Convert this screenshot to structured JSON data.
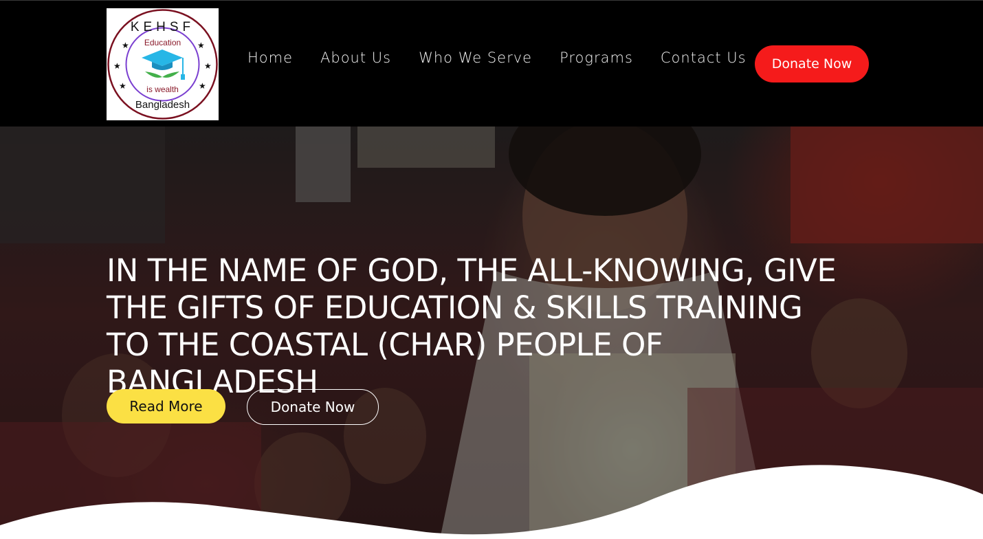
{
  "logo": {
    "top_text": "KEHSF",
    "inner_top": "Education",
    "inner_bottom": "is wealth",
    "bottom_text": "Bangladesh"
  },
  "nav": {
    "items": [
      "Home",
      "About Us",
      "Who We Serve",
      "Programs",
      "Contact Us"
    ],
    "donate_label": "Donate Now"
  },
  "hero": {
    "title": "IN THE NAME OF GOD, THE ALL-KNOWING, GIVE THE GIFTS OF EDUCATION & SKILLS TRAINING TO THE COASTAL (CHAR) PEOPLE OF BANGLADESH",
    "read_more_label": "Read More",
    "donate_label": "Donate Now"
  },
  "colors": {
    "header_bg": "#000000",
    "donate_red": "#f51b1b",
    "read_more_yellow": "#fbe044",
    "logo_maroon": "#7a1020",
    "logo_purple": "#7a3fd0",
    "logo_cap_blue": "#27b6e6",
    "logo_leaf_green": "#43b04a"
  }
}
